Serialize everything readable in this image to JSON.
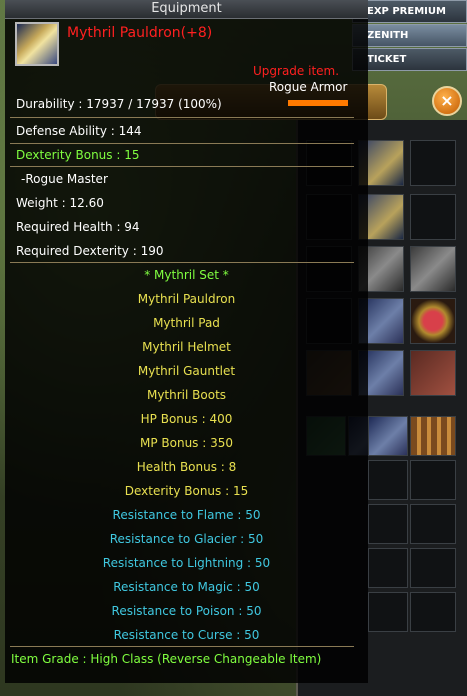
{
  "window_title": "Equipment",
  "item": {
    "name": "Mythril Pauldron(+8)",
    "upgrade_note": "Upgrade item.",
    "type": "Rogue Armor",
    "durability": "Durability : 17937 / 17937 (100%)",
    "stats": [
      "Defense Ability : 144",
      "Dexterity Bonus : 15"
    ],
    "class": "-Rogue Master",
    "requirements": [
      "Weight : 12.60",
      "Required Health : 94",
      "Required Dexterity : 190"
    ],
    "set_title": "* Mythril Set *",
    "set_items": [
      "Mythril Pauldron",
      "Mythril Pad",
      "Mythril Helmet",
      "Mythril Gauntlet",
      "Mythril Boots"
    ],
    "set_bonuses": [
      "HP Bonus : 400",
      "MP Bonus : 350",
      "Health Bonus : 8",
      "Dexterity Bonus : 15"
    ],
    "resistances": [
      "Resistance to Flame : 50",
      "Resistance to Glacier : 50",
      "Resistance to Lightning : 50",
      "Resistance to Magic : 50",
      "Resistance to Poison : 50",
      "Resistance to Curse : 50"
    ],
    "grade": "Item Grade : High Class (Reverse Changeable Item)"
  },
  "top_menu": [
    "EXP PREMIUM",
    "ZENITH",
    "TICKET"
  ],
  "inventory": {
    "close_icon": "close-icon"
  },
  "colors": {
    "name": "#ff2020",
    "green_stat": "#80ff40",
    "set": "#e8e050",
    "resistance": "#40c8e0",
    "durability_bar": "#ff7a00"
  }
}
